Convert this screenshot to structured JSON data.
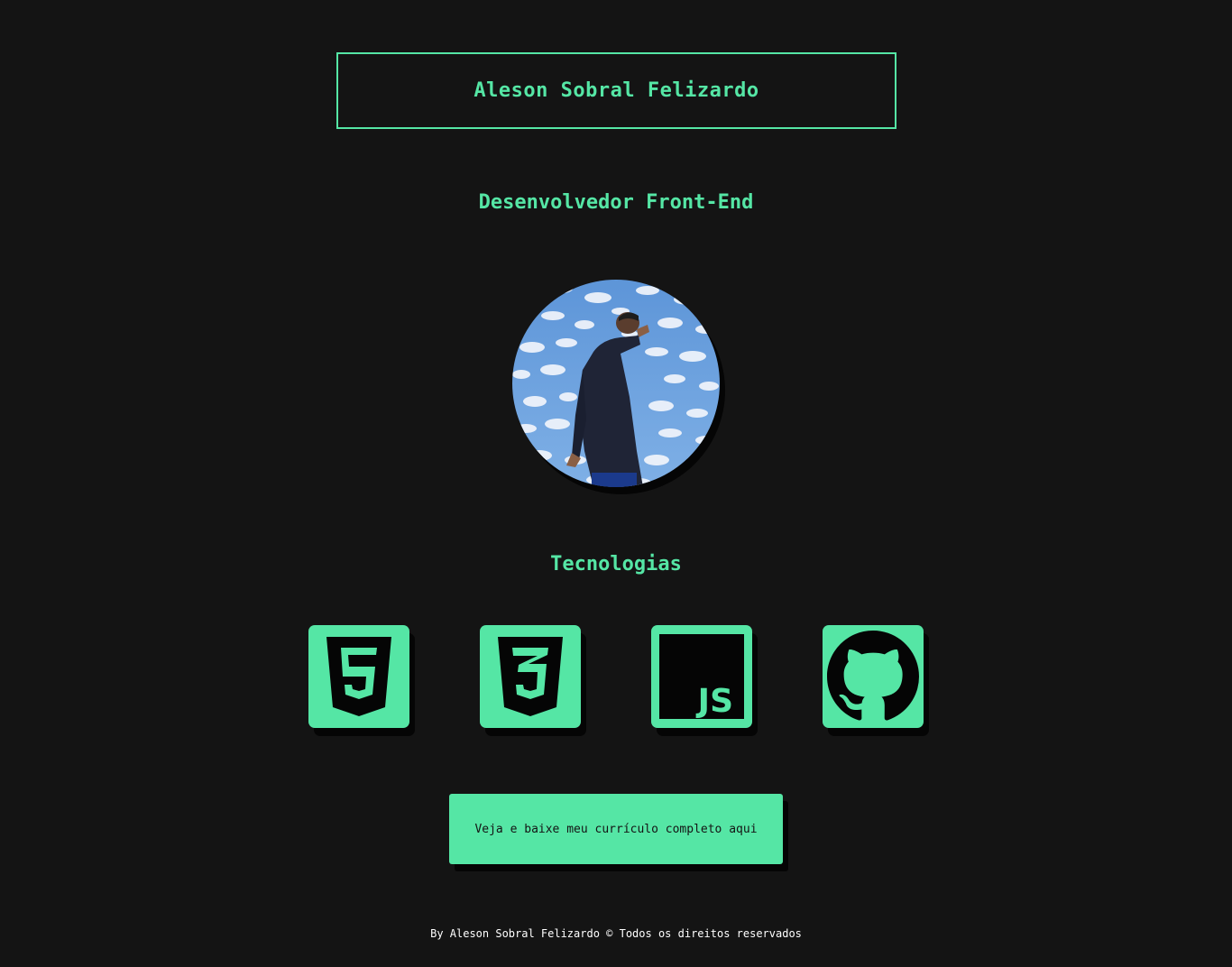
{
  "header": {
    "name": "Aleson Sobral Felizardo"
  },
  "role": "Desenvolvedor Front-End",
  "profile": {
    "photo_icon": "profile-photo"
  },
  "technologies": {
    "title": "Tecnologias",
    "items": [
      {
        "icon": "html5-icon"
      },
      {
        "icon": "css3-icon"
      },
      {
        "icon": "javascript-icon",
        "label": "JS"
      },
      {
        "icon": "github-icon"
      }
    ]
  },
  "cta": {
    "label": "Veja e baixe meu currículo completo aqui"
  },
  "footer": {
    "text": "By Aleson Sobral Felizardo © Todos os direitos reservados"
  },
  "colors": {
    "background": "#141414",
    "accent": "#55e6a5",
    "text_light": "#ffffff",
    "shadow": "#050505"
  }
}
